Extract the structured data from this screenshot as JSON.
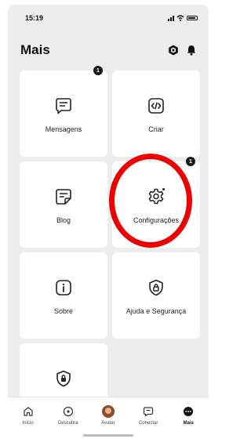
{
  "status_bar": {
    "time": "15:19"
  },
  "header": {
    "title": "Mais"
  },
  "cards": {
    "messages": {
      "label": "Mensagens",
      "badge": "1"
    },
    "create": {
      "label": "Criar"
    },
    "blog": {
      "label": "Blog"
    },
    "settings": {
      "label": "Configurações",
      "badge": "1"
    },
    "about": {
      "label": "Sobre"
    },
    "help": {
      "label": "Ajuda e Segurança"
    }
  },
  "tab_bar": {
    "home": "Início",
    "discover": "Descubra",
    "avatar": "Avatar",
    "connect": "Conectar",
    "more": "Mais"
  },
  "colors": {
    "background": "#ededed",
    "card": "#ffffff",
    "highlight": "#ee0000",
    "badge": "#1a1a1a"
  },
  "icons": {
    "messages": "message-icon",
    "create": "code-icon",
    "blog": "blog-icon",
    "settings": "gear-icon",
    "about": "info-icon",
    "help": "shield-lock-icon",
    "extra": "shield-icon"
  }
}
